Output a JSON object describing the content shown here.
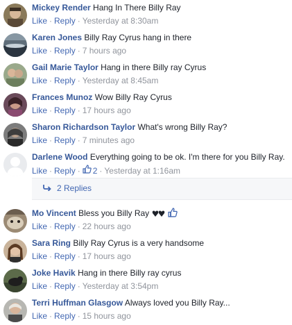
{
  "actions": {
    "like": "Like",
    "reply": "Reply"
  },
  "comments": [
    {
      "author": "Mickey Render",
      "text": "Hang In There Billy Ray",
      "time": "Yesterday at 8:30am"
    },
    {
      "author": "Karen Jones",
      "text": "Billy Ray Cyrus hang in there",
      "time": "7 hours ago"
    },
    {
      "author": "Gail Marie Taylor",
      "text": "Hang in there Billy ray Cyrus",
      "time": "Yesterday at 8:45am"
    },
    {
      "author": "Frances Munoz",
      "text": "Wow Billy Ray Cyrus",
      "time": "17 hours ago"
    },
    {
      "author": "Sharon Richardson Taylor",
      "text": "What's wrong Billy Ray?",
      "time": "7 minutes ago"
    },
    {
      "author": "Darlene Wood",
      "text": "Everything going to be ok. I'm there for you Billy Ray.",
      "time": "Yesterday at 1:16am",
      "like_count": "2"
    },
    {
      "author": "Mo Vincent",
      "text": "Bless you Billy Ray",
      "time": "22 hours ago"
    },
    {
      "author": "Sara Ring",
      "text": "Billy Ray Cyrus is a very handsome",
      "time": "17 hours ago"
    },
    {
      "author": "Joke Havik",
      "text": "Hang in there Billy ray cyrus",
      "time": "Yesterday at 3:54pm"
    },
    {
      "author": "Terri Huffman Glasgow",
      "text": "Always loved you Billy Ray...",
      "time": "15 hours ago"
    }
  ],
  "replies": {
    "label": "2 Replies"
  },
  "colors": {
    "author": "#365899",
    "link": "#4267b2",
    "meta": "#90949c",
    "replies_bg": "#f6f7f9"
  },
  "icons": {
    "reply_arrow": "reply-arrow-icon",
    "like_thumb": "thumbs-up-icon"
  }
}
